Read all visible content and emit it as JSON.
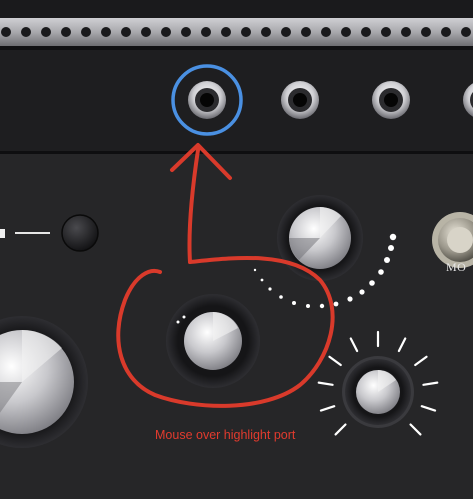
{
  "annotation": {
    "caption": "Mouse over highlight port",
    "arrow_color": "#d93a2b",
    "highlight_color": "#4a90e2"
  },
  "panel": {
    "mode_label": "MO"
  },
  "colors": {
    "rail": "#a8a8ac",
    "panel_top": "#1e1e20",
    "panel_main": "#262628"
  },
  "icons": {
    "port": "jack-socket-icon",
    "knob": "knob-icon",
    "button": "push-button-icon"
  }
}
